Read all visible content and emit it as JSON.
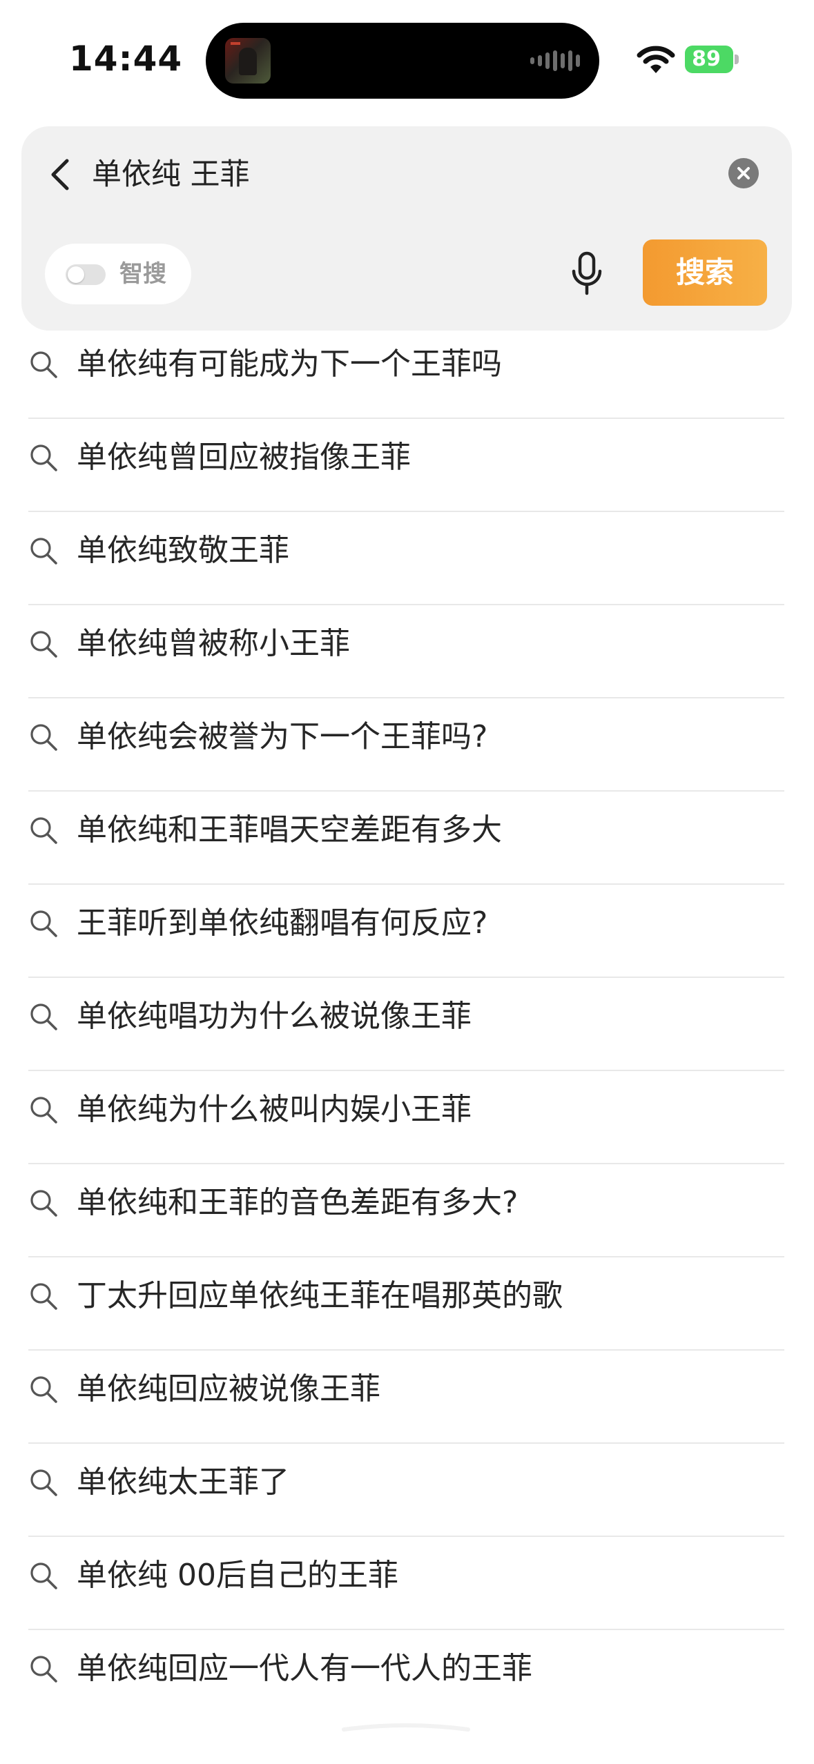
{
  "status_bar": {
    "time": "14:44",
    "battery_level": "89"
  },
  "search": {
    "query": "单依纯 王菲",
    "smart_search_label": "智搜",
    "smart_search_enabled": false,
    "search_button_label": "搜索",
    "accent_color": "#f5a33b"
  },
  "suggestions": [
    "单依纯有可能成为下一个王菲吗",
    "单依纯曾回应被指像王菲",
    "单依纯致敬王菲",
    "单依纯曾被称小王菲",
    "单依纯会被誉为下一个王菲吗?",
    "单依纯和王菲唱天空差距有多大",
    "王菲听到单依纯翻唱有何反应?",
    "单依纯唱功为什么被说像王菲",
    "单依纯为什么被叫内娱小王菲",
    "单依纯和王菲的音色差距有多大?",
    "丁太升回应单依纯王菲在唱那英的歌",
    "单依纯回应被说像王菲",
    "单依纯太王菲了",
    "单依纯 00后自己的王菲",
    "单依纯回应一代人有一代人的王菲"
  ],
  "icons": {
    "back": "chevron-left-icon",
    "clear": "close-circle-icon",
    "mic": "microphone-icon",
    "suggestion": "search-icon",
    "wifi": "wifi-icon",
    "battery": "battery-charging-icon"
  }
}
